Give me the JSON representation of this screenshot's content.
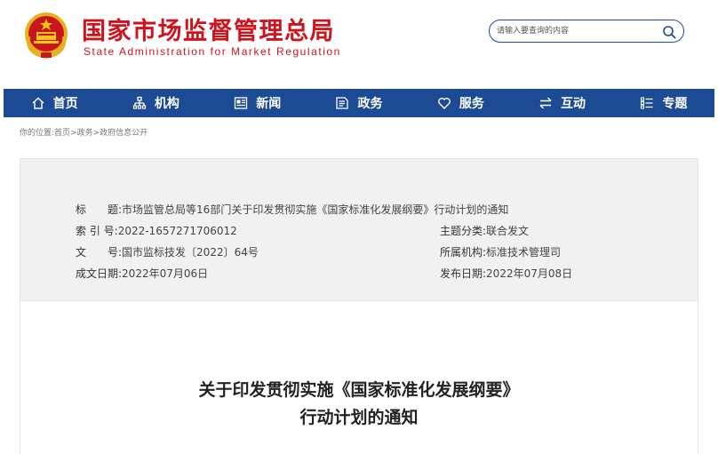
{
  "header": {
    "title": "国家市场监督管理总局",
    "subtitle": "State Administration for Market Regulation",
    "search_placeholder": "请输入要查询的内容"
  },
  "nav": [
    {
      "label": "首页",
      "icon": "home-icon"
    },
    {
      "label": "机构",
      "icon": "org-icon"
    },
    {
      "label": "新闻",
      "icon": "news-icon"
    },
    {
      "label": "政务",
      "icon": "affairs-icon"
    },
    {
      "label": "服务",
      "icon": "heart-icon"
    },
    {
      "label": "互动",
      "icon": "exchange-icon"
    },
    {
      "label": "专题",
      "icon": "list-icon"
    }
  ],
  "breadcrumb": {
    "prefix": "你的位置:",
    "items": [
      "首页",
      "政务",
      "政府信息公开"
    ],
    "separator": ">"
  },
  "info": {
    "title_key": "标　　题:",
    "title_val": "市场监管总局等16部门关于印发贯彻实施《国家标准化发展纲要》行动计划的通知",
    "index_key": "索 引 号:",
    "index_val": "2022-1657271706012",
    "topic_key": "主题分类:",
    "topic_val": "联合发文",
    "doc_key": "文　　号:",
    "doc_val": "国市监标技发〔2022〕64号",
    "org_key": "所属机构:",
    "org_val": "标准技术管理司",
    "created_key": "成文日期:",
    "created_val": "2022年07月06日",
    "published_key": "发布日期:",
    "published_val": "2022年07月08日"
  },
  "article": {
    "title_line1": "关于印发贯彻实施《国家标准化发展纲要》",
    "title_line2": "行动计划的通知"
  },
  "colors": {
    "brand_red": "#d0121b",
    "nav_blue": "#1d4b93",
    "panel_gray": "#f1f1f1"
  }
}
